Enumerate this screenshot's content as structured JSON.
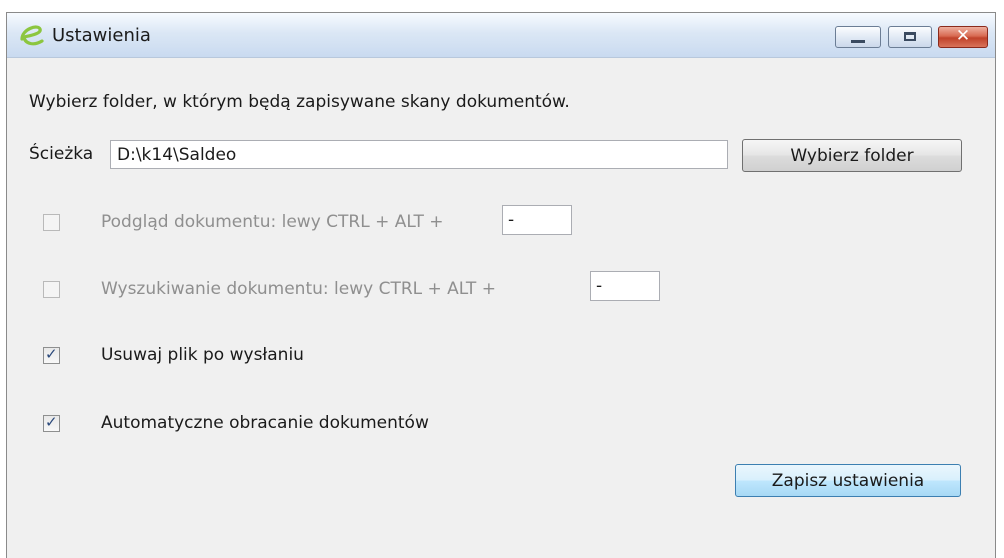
{
  "window": {
    "title": "Ustawienia",
    "icon": "saldeo-e-logo",
    "controls": {
      "minimize": "minimize-icon",
      "maximize": "maximize-icon",
      "close": "✕"
    }
  },
  "instructions": "Wybierz folder, w którym będą zapisywane skany dokumentów.",
  "path": {
    "label": "Ścieżka",
    "value": "D:\\k14\\Saldeo",
    "button_label": "Wybierz folder"
  },
  "options": [
    {
      "label": "Podgląd dokumentu: lewy CTRL + ALT +",
      "key": "-",
      "checked": false,
      "enabled": false
    },
    {
      "label": "Wyszukiwanie dokumentu: lewy CTRL + ALT +",
      "key": "-",
      "checked": false,
      "enabled": false
    },
    {
      "label": "Usuwaj plik po wysłaniu",
      "checked": true,
      "enabled": true
    },
    {
      "label": "Automatyczne obracanie dokumentów",
      "checked": true,
      "enabled": true
    }
  ],
  "save_button_label": "Zapisz ustawienia",
  "colors": {
    "logo_green": "#8cc63f",
    "primary_button": "#bee6fd",
    "close_button": "#c0422a"
  }
}
